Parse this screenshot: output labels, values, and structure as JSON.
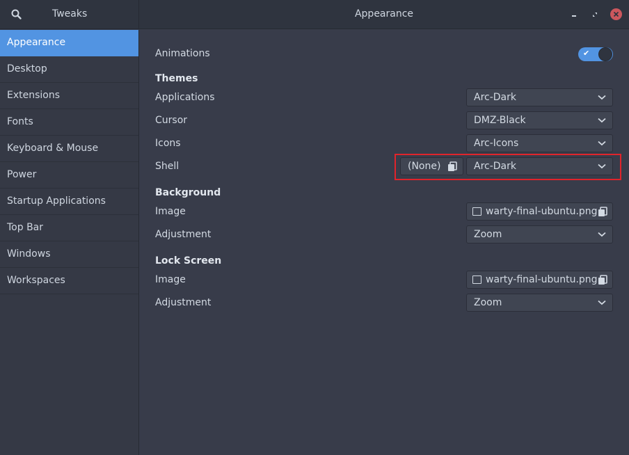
{
  "app": {
    "title": "Tweaks",
    "window_title": "Appearance"
  },
  "sidebar": {
    "items": [
      {
        "label": "Appearance",
        "active": true
      },
      {
        "label": "Desktop"
      },
      {
        "label": "Extensions"
      },
      {
        "label": "Fonts"
      },
      {
        "label": "Keyboard & Mouse"
      },
      {
        "label": "Power"
      },
      {
        "label": "Startup Applications"
      },
      {
        "label": "Top Bar"
      },
      {
        "label": "Windows"
      },
      {
        "label": "Workspaces"
      }
    ]
  },
  "main": {
    "animations": {
      "label": "Animations",
      "enabled": true
    },
    "themes": {
      "title": "Themes",
      "applications": {
        "label": "Applications",
        "value": "Arc-Dark"
      },
      "cursor": {
        "label": "Cursor",
        "value": "DMZ-Black"
      },
      "icons": {
        "label": "Icons",
        "value": "Arc-Icons"
      },
      "shell": {
        "label": "Shell",
        "reset_value": "(None)",
        "value": "Arc-Dark"
      }
    },
    "background": {
      "title": "Background",
      "image": {
        "label": "Image",
        "value": "warty-final-ubuntu.png"
      },
      "adjustment": {
        "label": "Adjustment",
        "value": "Zoom"
      }
    },
    "lock_screen": {
      "title": "Lock Screen",
      "image": {
        "label": "Image",
        "value": "warty-final-ubuntu.png"
      },
      "adjustment": {
        "label": "Adjustment",
        "value": "Zoom"
      }
    }
  },
  "colors": {
    "accent": "#5294e2",
    "background": "#383c4a",
    "sidebar": "#353945",
    "titlebar": "#2f343f",
    "close_button": "#cc575d",
    "highlight_box": "#e0242b"
  },
  "icons": [
    "search-icon",
    "minimize-icon",
    "maximize-icon",
    "close-icon",
    "chevron-down-icon",
    "document-icon",
    "image-icon",
    "check-icon"
  ]
}
